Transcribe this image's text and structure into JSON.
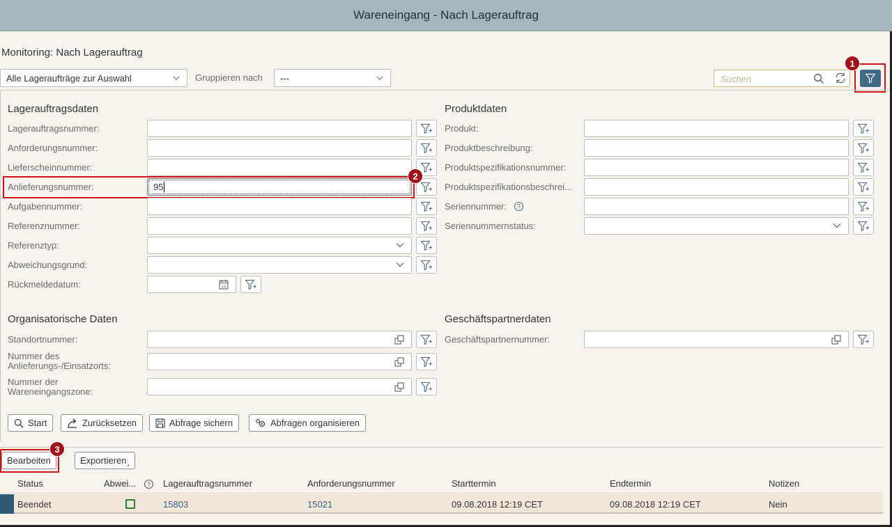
{
  "window": {
    "title": "Wareneingang - Nach Lagerauftrag"
  },
  "page": {
    "title": "Monitoring: Nach Lagerauftrag"
  },
  "toolbar": {
    "selection_value": "Alle Lageraufträge zur Auswahl",
    "group_label": "Gruppieren nach",
    "group_value": "---",
    "search_placeholder": "Suchen"
  },
  "callouts": {
    "one": "1",
    "two": "2",
    "three": "3"
  },
  "sections": {
    "warehouse": {
      "title": "Lagerauftragsdaten",
      "fields": [
        {
          "label": "Lagerauftragsnummer:",
          "value": ""
        },
        {
          "label": "Anforderungsnummer:",
          "value": ""
        },
        {
          "label": "Lieferscheinnummer:",
          "value": ""
        },
        {
          "label": "Anlieferungsnummer:",
          "value": "95"
        },
        {
          "label": "Aufgabennummer:",
          "value": ""
        },
        {
          "label": "Referenznummer:",
          "value": ""
        },
        {
          "label": "Referenztyp:",
          "value": ""
        },
        {
          "label": "Abweichungsgrund:",
          "value": ""
        },
        {
          "label": "Rückmeldedatum:",
          "value": ""
        }
      ]
    },
    "product": {
      "title": "Produktdaten",
      "fields": [
        {
          "label": "Produkt:",
          "value": ""
        },
        {
          "label": "Produktbeschreibung:",
          "value": ""
        },
        {
          "label": "Produktspezifikationsnummer:",
          "value": ""
        },
        {
          "label": "Produktspezifikationsbeschrei...",
          "value": ""
        },
        {
          "label": "Seriennummer:",
          "value": ""
        },
        {
          "label": "Seriennummernstatus:",
          "value": ""
        }
      ]
    },
    "org": {
      "title": "Organisatorische Daten",
      "fields": [
        {
          "label": "Standortnummer:",
          "value": ""
        },
        {
          "label_line1": "Nummer des",
          "label_line2": "Anlieferungs-/Einsatzorts:",
          "value": ""
        },
        {
          "label_line1": "Nummer der",
          "label_line2": "Wareneingangszone:",
          "value": ""
        }
      ]
    },
    "partner": {
      "title": "Geschäftspartnerdaten",
      "fields": [
        {
          "label": "Geschäftspartnernummer:",
          "value": ""
        }
      ]
    }
  },
  "actions": {
    "start": "Start",
    "reset": "Zurücksetzen",
    "save_query": "Abfrage sichern",
    "organize_queries": "Abfragen organisieren"
  },
  "table_toolbar": {
    "edit": "Bearbeiten",
    "export": "Exportieren"
  },
  "table": {
    "columns": [
      "Status",
      "Abwei...",
      "Lagerauftragsnummer",
      "Anforderungsnummer",
      "Starttermin",
      "Endtermin",
      "Notizen"
    ],
    "rows": [
      {
        "status": "Beendet",
        "order": "15803",
        "request": "15021",
        "start": "09.08.2018 12:19 CET",
        "end": "09.08.2018 12:19 CET",
        "notes": "Nein"
      }
    ]
  },
  "colors": {
    "titlebar": "#a7b6bc",
    "primary": "#3f6b86",
    "callout": "#d0121b",
    "row_highlight": "#f1e7d8",
    "link": "#346187"
  }
}
